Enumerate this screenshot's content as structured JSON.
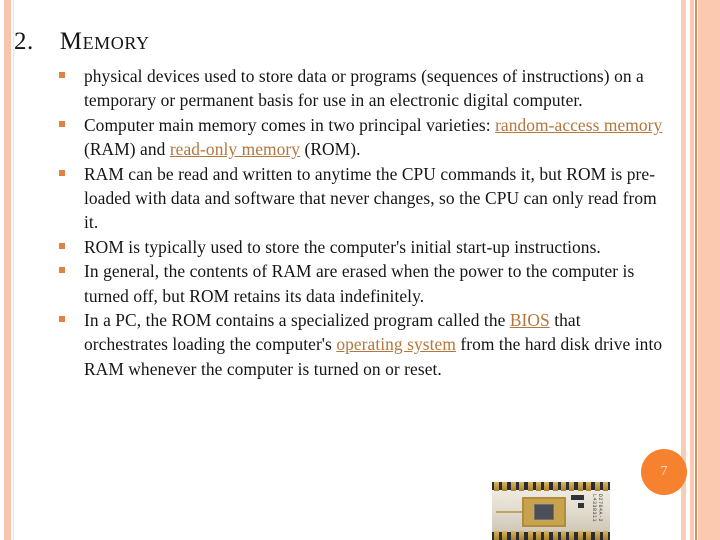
{
  "slide": {
    "title_number": "2.",
    "title_text": "Memory",
    "page_number": "7"
  },
  "colors": {
    "accent_orange": "#f6822f",
    "bullet_marker": "#e08243",
    "link": "#b5763c",
    "border_peach": "#f9c6ad",
    "border_dark_stripe": "#d98e55",
    "text": "#151515"
  },
  "bullets": [
    {
      "id": "bullet-definition",
      "segments": [
        {
          "type": "text",
          "value": "physical devices used to store data or programs (sequences of instructions) on a temporary or permanent basis for use in an electronic digital computer."
        }
      ]
    },
    {
      "id": "bullet-varieties",
      "segments": [
        {
          "type": "text",
          "value": "Computer main memory comes in two principal varieties: "
        },
        {
          "type": "link",
          "value": "random-access memory"
        },
        {
          "type": "text",
          "value": " (RAM) and "
        },
        {
          "type": "link",
          "value": "read-only memory"
        },
        {
          "type": "text",
          "value": " (ROM)."
        }
      ]
    },
    {
      "id": "bullet-ram-vs-rom",
      "segments": [
        {
          "type": "text",
          "value": "RAM can be read and written to anytime the CPU commands it, but ROM is pre-loaded with data and software that never changes, so the CPU can only read from it."
        }
      ]
    },
    {
      "id": "bullet-rom-startup",
      "segments": [
        {
          "type": "text",
          "value": "ROM is typically used to store the computer's initial start-up instructions."
        }
      ]
    },
    {
      "id": "bullet-volatility",
      "segments": [
        {
          "type": "text",
          "value": "In general, the contents of RAM are erased when the power to the computer is turned off, but ROM retains its data indefinitely."
        }
      ]
    },
    {
      "id": "bullet-bios",
      "segments": [
        {
          "type": "text",
          "value": "In a PC, the ROM contains a specialized program called the "
        },
        {
          "type": "link",
          "value": "BIOS"
        },
        {
          "type": "text",
          "value": " that orchestrates loading the computer's "
        },
        {
          "type": "link",
          "value": "operating system"
        },
        {
          "type": "text",
          "value": " from the hard disk drive into RAM whenever the computer is turned on or reset."
        }
      ]
    }
  ],
  "chip_image": {
    "name": "eprom-chip-photo",
    "label_text": "D2764A-2\nL4338311"
  }
}
